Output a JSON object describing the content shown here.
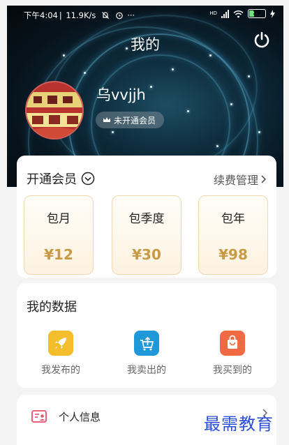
{
  "status_bar": {
    "time": "下午4:04",
    "net_speed": "11.9K/s",
    "more": "···",
    "net_type": "HD",
    "battery": "29",
    "battery_level": 0.29
  },
  "header": {
    "title": "我的"
  },
  "profile": {
    "username": "乌vvjjh",
    "vip_status": "未开通会员"
  },
  "membership": {
    "title": "开通会员",
    "renew_label": "续费管理",
    "plans": [
      {
        "name": "包月",
        "price": "¥12"
      },
      {
        "name": "包季度",
        "price": "¥30"
      },
      {
        "name": "包年",
        "price": "¥98"
      }
    ]
  },
  "my_data": {
    "title": "我的数据",
    "items": [
      {
        "label": "我发布的",
        "icon": "rocket-icon",
        "color": "#f3bd2b"
      },
      {
        "label": "我卖出的",
        "icon": "cart-upload-icon",
        "color": "#1f98d9"
      },
      {
        "label": "我买到的",
        "icon": "shopping-bag-icon",
        "color": "#ef6a43"
      }
    ]
  },
  "menu": {
    "items": [
      {
        "label": "个人信息",
        "icon": "profile-card-icon",
        "color": "#e64f6a"
      }
    ]
  },
  "watermark": "最需教育",
  "colors": {
    "accent_gold": "#c89a45",
    "gold_border": "#f0d9b1",
    "info_pink": "#e64f6a"
  }
}
